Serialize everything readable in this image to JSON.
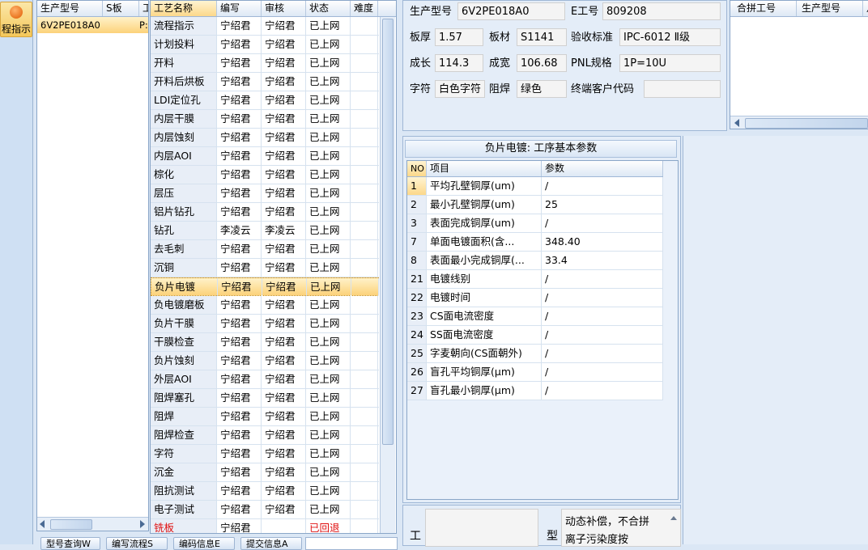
{
  "toolbar": {
    "button_label": "程指示"
  },
  "model_list": {
    "columns": [
      "生产型号",
      "S板",
      "工"
    ],
    "rows": [
      [
        "6V2PE018A0",
        "",
        "P:"
      ]
    ]
  },
  "process_list": {
    "columns": [
      "工艺名称",
      "编写",
      "审核",
      "状态",
      "难度"
    ],
    "rows": [
      [
        "流程指示",
        "宁绍君",
        "宁绍君",
        "已上网"
      ],
      [
        "计划投料",
        "宁绍君",
        "宁绍君",
        "已上网"
      ],
      [
        "开料",
        "宁绍君",
        "宁绍君",
        "已上网"
      ],
      [
        "开料后烘板",
        "宁绍君",
        "宁绍君",
        "已上网"
      ],
      [
        "LDI定位孔",
        "宁绍君",
        "宁绍君",
        "已上网"
      ],
      [
        "内层干膜",
        "宁绍君",
        "宁绍君",
        "已上网"
      ],
      [
        "内层蚀刻",
        "宁绍君",
        "宁绍君",
        "已上网"
      ],
      [
        "内层AOI",
        "宁绍君",
        "宁绍君",
        "已上网"
      ],
      [
        "棕化",
        "宁绍君",
        "宁绍君",
        "已上网"
      ],
      [
        "层压",
        "宁绍君",
        "宁绍君",
        "已上网"
      ],
      [
        "铝片钻孔",
        "宁绍君",
        "宁绍君",
        "已上网"
      ],
      [
        "钻孔",
        "李凌云",
        "李凌云",
        "已上网"
      ],
      [
        "去毛刺",
        "宁绍君",
        "宁绍君",
        "已上网"
      ],
      [
        "沉铜",
        "宁绍君",
        "宁绍君",
        "已上网"
      ],
      [
        "负片电镀",
        "宁绍君",
        "宁绍君",
        "已上网"
      ],
      [
        "负电镀磨板",
        "宁绍君",
        "宁绍君",
        "已上网"
      ],
      [
        "负片干膜",
        "宁绍君",
        "宁绍君",
        "已上网"
      ],
      [
        "干膜检查",
        "宁绍君",
        "宁绍君",
        "已上网"
      ],
      [
        "负片蚀刻",
        "宁绍君",
        "宁绍君",
        "已上网"
      ],
      [
        "外层AOI",
        "宁绍君",
        "宁绍君",
        "已上网"
      ],
      [
        "阻焊塞孔",
        "宁绍君",
        "宁绍君",
        "已上网"
      ],
      [
        "阻焊",
        "宁绍君",
        "宁绍君",
        "已上网"
      ],
      [
        "阻焊检查",
        "宁绍君",
        "宁绍君",
        "已上网"
      ],
      [
        "字符",
        "宁绍君",
        "宁绍君",
        "已上网"
      ],
      [
        "沉金",
        "宁绍君",
        "宁绍君",
        "已上网"
      ],
      [
        "阻抗测试",
        "宁绍君",
        "宁绍君",
        "已上网"
      ],
      [
        "电子测试",
        "宁绍君",
        "宁绍君",
        "已上网"
      ],
      [
        "铣板",
        "宁绍君",
        "",
        "已回退"
      ]
    ],
    "selected_index": 14
  },
  "info": {
    "model_label": "生产型号",
    "model_value": "6V2PE018A0",
    "e_label": "E工号",
    "e_value": "809208",
    "thick_label": "板厚",
    "thick_value": "1.57",
    "material_label": "板材",
    "material_value": "S1141",
    "std_label": "验收标准",
    "std_value": "IPC-6012 Ⅱ级",
    "len_label": "成长",
    "len_value": "114.3",
    "wid_label": "成宽",
    "wid_value": "106.68",
    "pnl_label": "PNL规格",
    "pnl_value": "1P=10U",
    "char_label": "字符",
    "char_value": "白色字符",
    "mask_label": "阻焊",
    "mask_value": "绿色",
    "cust_label": "终端客户代码",
    "cust_value": ""
  },
  "merge_list": {
    "columns": [
      "合拼工号",
      "生产型号",
      "月"
    ]
  },
  "params": {
    "title": "负片电镀: 工序基本参数",
    "columns": [
      "NO",
      "项目",
      "参数"
    ],
    "rows": [
      [
        "1",
        "平均孔壁铜厚(um)",
        "/"
      ],
      [
        "2",
        "最小孔壁铜厚(um)",
        "25"
      ],
      [
        "3",
        "表面完成铜厚(um)",
        "/"
      ],
      [
        "7",
        "单面电镀面积(含...",
        "348.40"
      ],
      [
        "8",
        "表面最小完成铜厚(...",
        "33.4"
      ],
      [
        "21",
        "电镀线别",
        "/"
      ],
      [
        "22",
        "电镀时间",
        "/"
      ],
      [
        "23",
        "CS面电流密度",
        "/"
      ],
      [
        "24",
        "SS面电流密度",
        "/"
      ],
      [
        "25",
        "字麦朝向(CS面朝外)",
        "/"
      ],
      [
        "26",
        "盲孔平均铜厚(μm)",
        "/"
      ],
      [
        "27",
        "盲孔最小铜厚(μm)",
        "/"
      ]
    ]
  },
  "bottom": {
    "label_left": "工",
    "label_type": "型",
    "note_line1": "动态补偿，不合拼",
    "note_line2": "离子污染度按"
  },
  "bottom_buttons": [
    "型号查询W",
    "编写流程S",
    "编码信息E",
    "提交信息A"
  ]
}
